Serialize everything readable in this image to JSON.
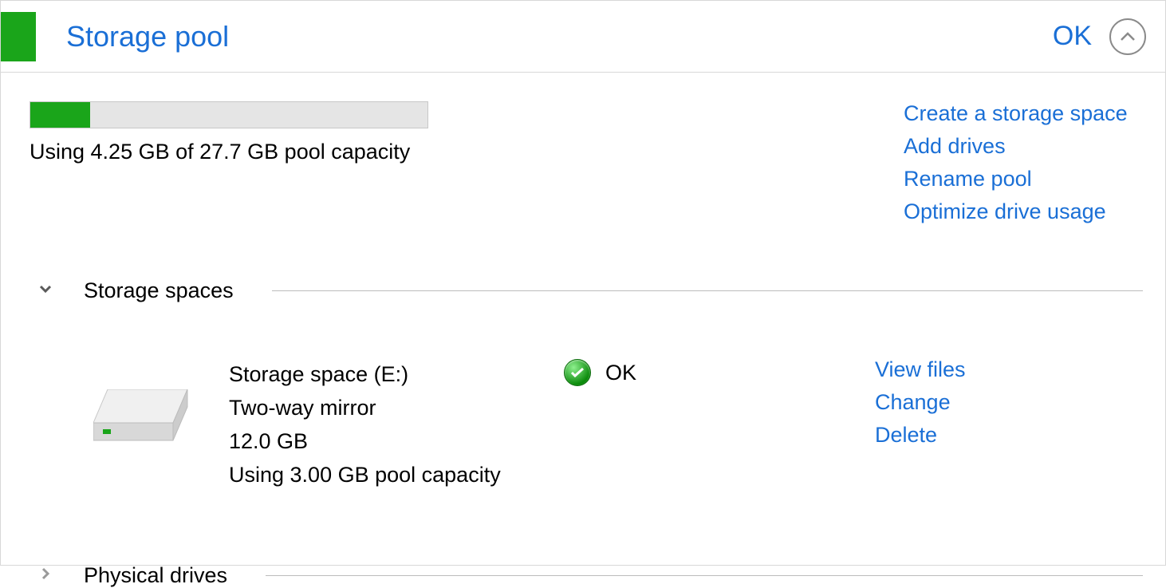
{
  "header": {
    "title": "Storage pool",
    "status": "OK"
  },
  "usage": {
    "text": "Using 4.25 GB of 27.7 GB pool capacity",
    "used_gb": 4.25,
    "total_gb": 27.7,
    "percent": 15
  },
  "pool_actions": {
    "create": "Create a storage space",
    "add": "Add drives",
    "rename": "Rename pool",
    "optimize": "Optimize drive usage"
  },
  "sections": {
    "storage_spaces": "Storage spaces",
    "physical_drives": "Physical drives"
  },
  "space": {
    "name": "Storage space (E:)",
    "type": "Two-way mirror",
    "size": "12.0 GB",
    "pool_usage": "Using 3.00 GB pool capacity",
    "status": "OK",
    "actions": {
      "view": "View files",
      "change": "Change",
      "delete": "Delete"
    }
  }
}
